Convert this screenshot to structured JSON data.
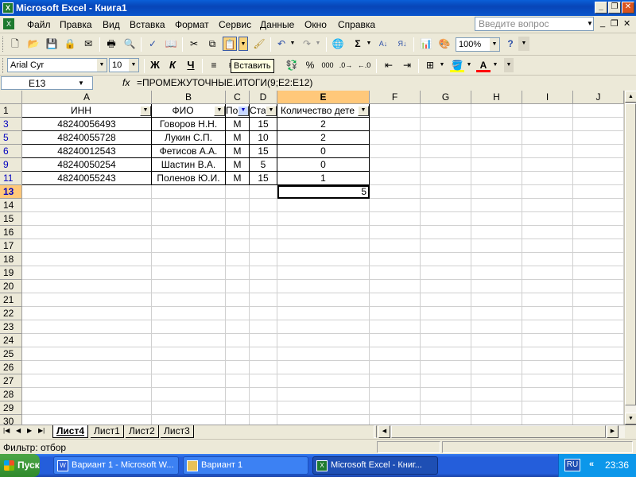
{
  "window": {
    "title": "Microsoft Excel - Книга1"
  },
  "menu": {
    "items": [
      "Файл",
      "Правка",
      "Вид",
      "Вставка",
      "Формат",
      "Сервис",
      "Данные",
      "Окно",
      "Справка"
    ],
    "help_placeholder": "Введите вопрос"
  },
  "toolbar": {
    "zoom": "100%",
    "font_name": "Arial Cyr",
    "font_size": "10",
    "bold": "Ж",
    "italic": "К",
    "underline": "Ч",
    "tooltip": "Вставить",
    "percent": "%",
    "thousands": "000"
  },
  "formula_bar": {
    "name_box": "E13",
    "fx": "fx",
    "formula": "=ПРОМЕЖУТОЧНЫЕ.ИТОГИ(9;E2:E12)"
  },
  "columns": [
    "A",
    "B",
    "C",
    "D",
    "E",
    "F",
    "G",
    "H",
    "I",
    "J"
  ],
  "header_row": {
    "row": "1",
    "a": "ИНН",
    "b": "ФИО",
    "c": "По",
    "d": "Ста",
    "e": "Количество дете"
  },
  "rows": [
    {
      "row": "3",
      "a": "48240056493",
      "b": "Говоров Н.Н.",
      "c": "М",
      "d": "15",
      "e": "2"
    },
    {
      "row": "5",
      "a": "48240055728",
      "b": "Лукин С.П.",
      "c": "М",
      "d": "10",
      "e": "2"
    },
    {
      "row": "6",
      "a": "48240012543",
      "b": "Фетисов А.А.",
      "c": "М",
      "d": "15",
      "e": "0"
    },
    {
      "row": "9",
      "a": "48240050254",
      "b": "Шастин В.А.",
      "c": "М",
      "d": "5",
      "e": "0"
    },
    {
      "row": "11",
      "a": "48240055243",
      "b": "Поленов Ю.И.",
      "c": "М",
      "d": "15",
      "e": "1"
    }
  ],
  "total_row": {
    "row": "13",
    "e": "5"
  },
  "empty_rows": [
    "14",
    "15",
    "16",
    "17",
    "18",
    "19",
    "20",
    "21",
    "22",
    "23",
    "24",
    "25",
    "26",
    "27",
    "28",
    "29",
    "30"
  ],
  "sheets": [
    "Лист4",
    "Лист1",
    "Лист2",
    "Лист3"
  ],
  "status": {
    "text": "Фильтр: отбор"
  },
  "taskbar": {
    "start": "Пуск",
    "tasks": [
      "Вариант 1 - Microsoft W...",
      "Вариант 1",
      "Microsoft Excel - Книг..."
    ],
    "lang": "RU",
    "time": "23:36"
  }
}
